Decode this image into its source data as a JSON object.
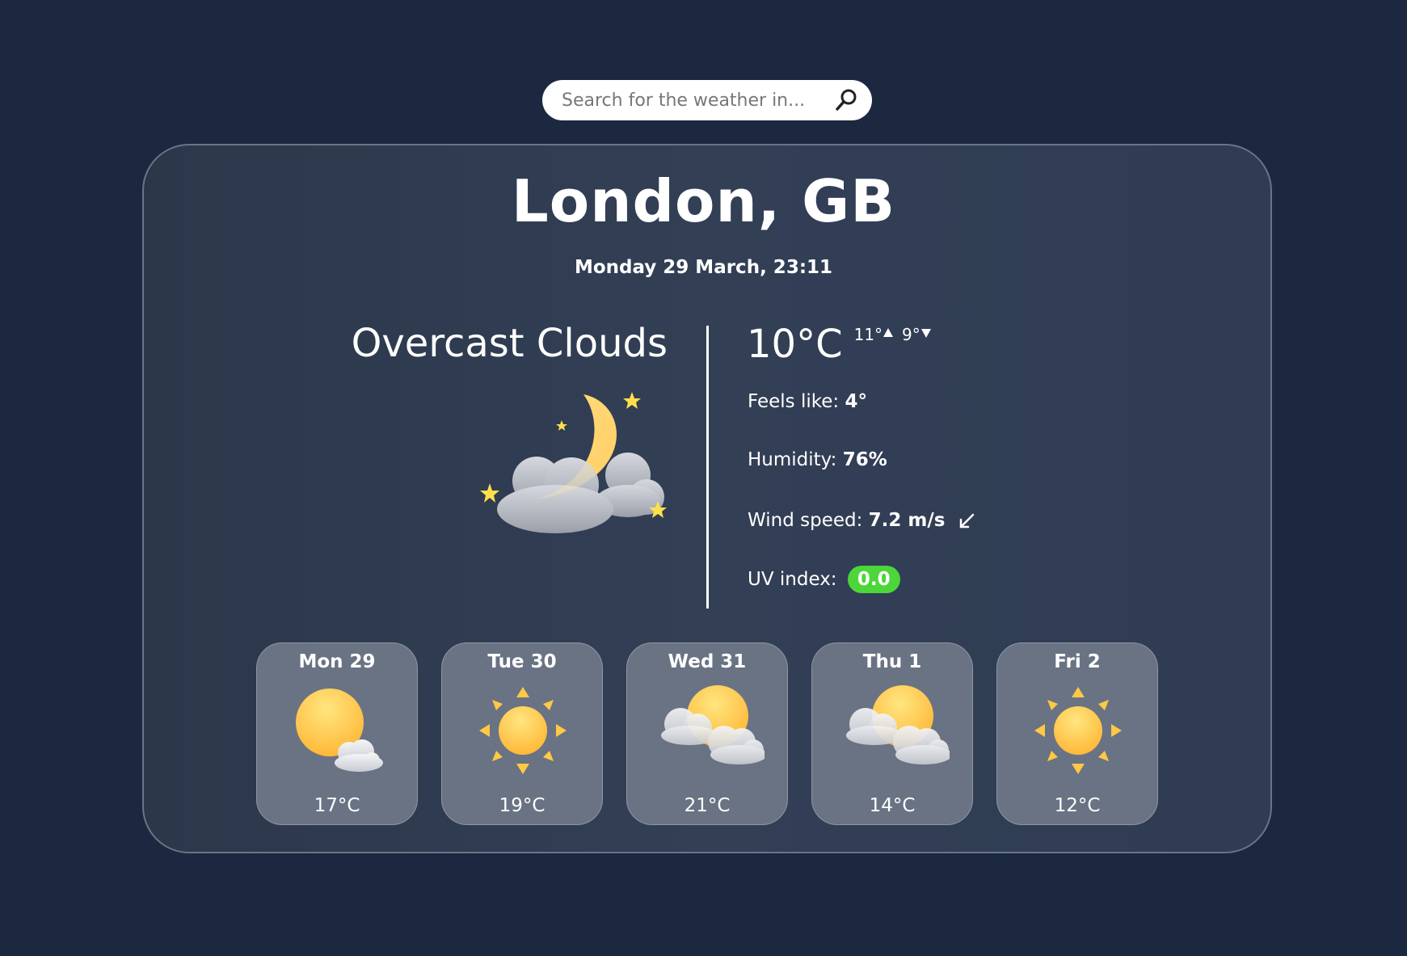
{
  "search": {
    "placeholder": "Search for the weather in..."
  },
  "location": "London, GB",
  "datetime": "Monday 29 March, 23:11",
  "current": {
    "condition": "Overcast Clouds",
    "icon": "moon-cloud-stars-icon",
    "temp": "10°C",
    "high": "11°",
    "low": "9°",
    "feels_like_label": "Feels like:",
    "feels_like": "4°",
    "humidity_label": "Humidity:",
    "humidity": "76%",
    "wind_label": "Wind speed:",
    "wind": "7.2 m/s",
    "wind_icon": "wind-direction-arrow-icon",
    "uv_label": "UV index:",
    "uv": "0.0",
    "uv_color": "#4cd63a"
  },
  "forecast": [
    {
      "day": "Mon 29",
      "temp": "17°C",
      "icon": "sun-small-cloud-icon"
    },
    {
      "day": "Tue 30",
      "temp": "19°C",
      "icon": "sun-icon"
    },
    {
      "day": "Wed 31",
      "temp": "21°C",
      "icon": "sun-clouds-icon"
    },
    {
      "day": "Thu 1",
      "temp": "14°C",
      "icon": "sun-clouds-icon"
    },
    {
      "day": "Fri 2",
      "temp": "12°C",
      "icon": "sun-icon"
    }
  ]
}
